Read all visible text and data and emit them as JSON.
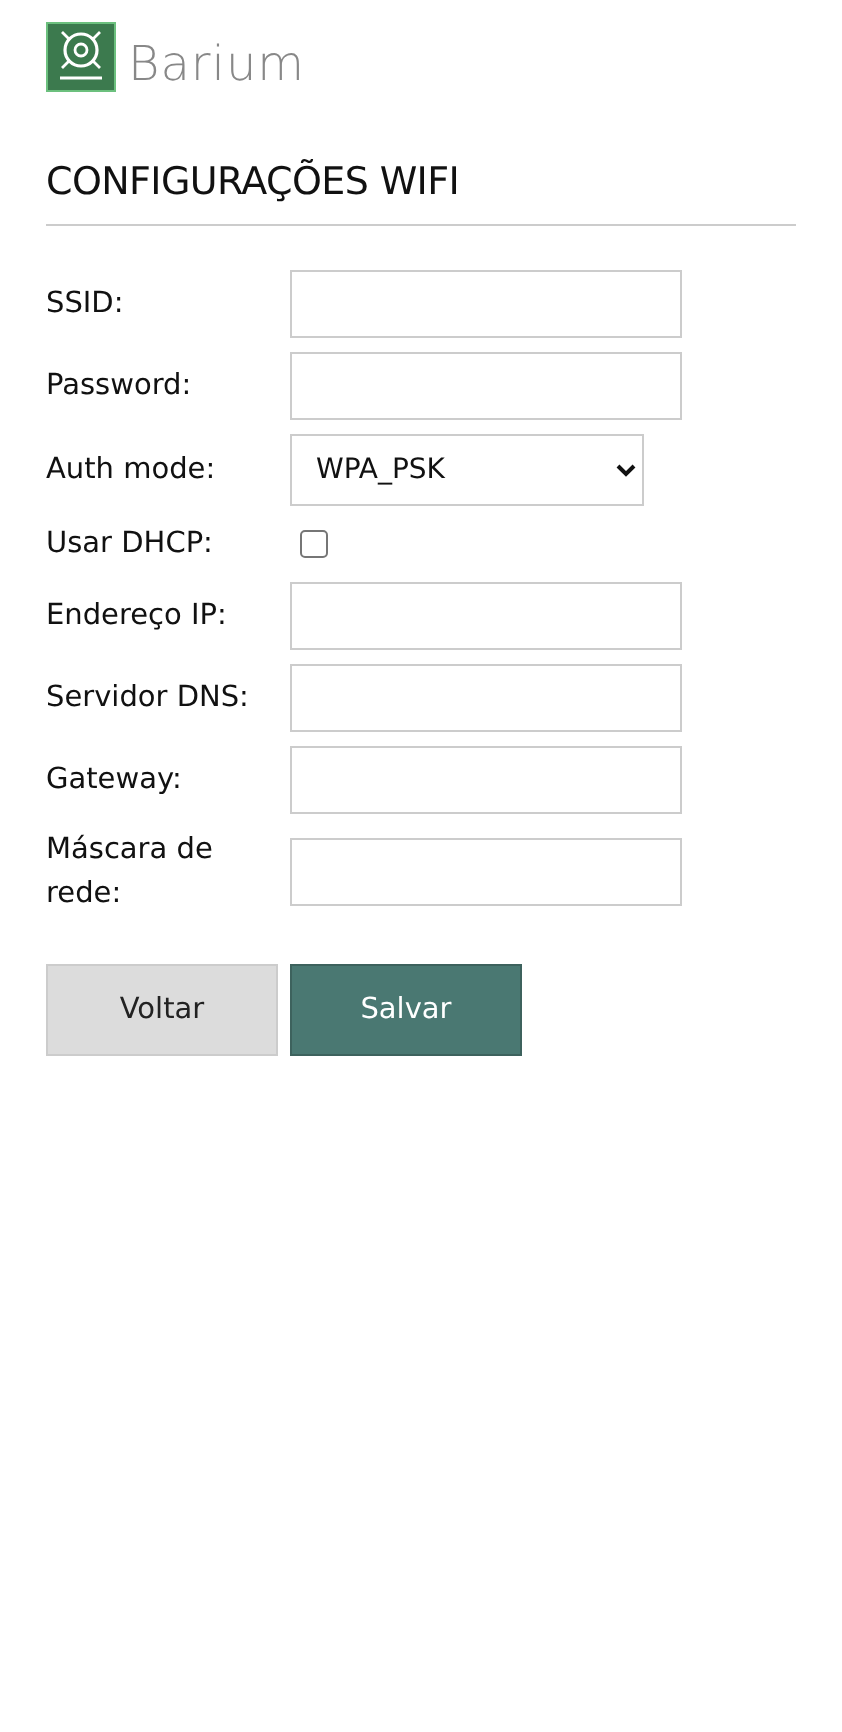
{
  "brand": {
    "name": "Barium"
  },
  "title": "CONFIGURAÇÕES WIFI",
  "fields": [
    {
      "kind": "text",
      "label": "SSID:"
    },
    {
      "kind": "text",
      "label": "Password:"
    },
    {
      "kind": "select",
      "label": "Auth mode:",
      "value": "WPA_PSK"
    },
    {
      "kind": "checkbox",
      "label": "Usar DHCP:",
      "checked": false
    },
    {
      "kind": "text",
      "label": "Endereço IP:"
    },
    {
      "kind": "text",
      "label": "Servidor DNS:"
    },
    {
      "kind": "text",
      "label": "Gateway:"
    },
    {
      "kind": "text",
      "label": "Máscara de rede:"
    }
  ],
  "buttons": [
    {
      "label": "Voltar",
      "kind": "secondary"
    },
    {
      "label": "Salvar",
      "kind": "primary"
    }
  ]
}
